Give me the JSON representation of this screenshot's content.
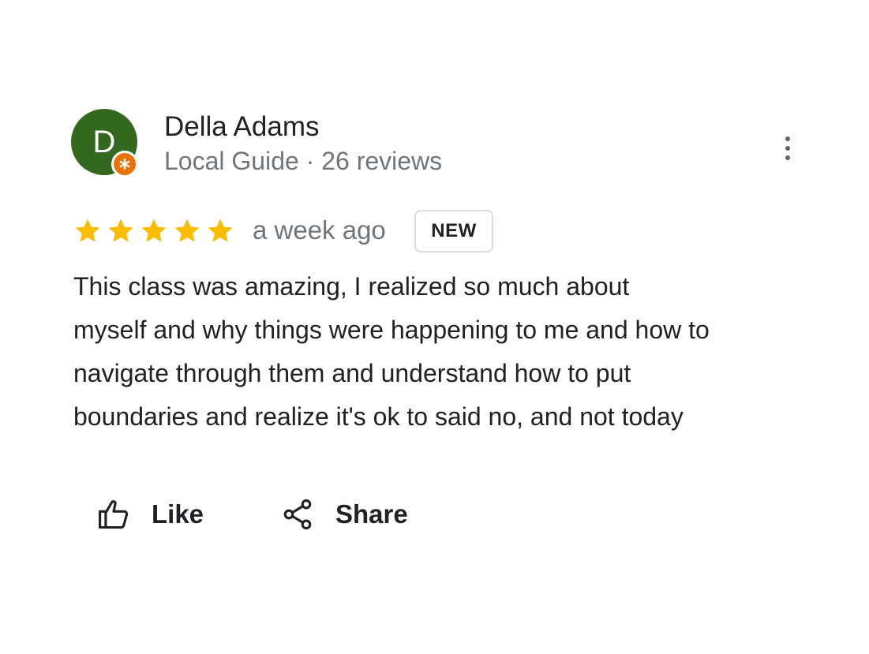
{
  "reviewer": {
    "initial": "D",
    "name": "Della Adams",
    "meta": "Local Guide · 26 reviews",
    "avatar_color": "#33691e",
    "badge_color": "#e8710a"
  },
  "review": {
    "rating": 5,
    "max_rating": 5,
    "star_color": "#fbbc04",
    "time": "a week ago",
    "badge": "NEW",
    "text": "This  class was amazing, I realized so much about\nmyself and why things were happening to me and how to\nnavigate through them and understand how to put\nboundaries and realize it's ok to said no, and not today"
  },
  "icons": {
    "more": "more-vert-icon",
    "like": "thumb-up-icon",
    "share": "share-icon",
    "badge": "local-guide-icon",
    "star": "star-icon"
  },
  "actions": {
    "like_label": "Like",
    "share_label": "Share"
  }
}
